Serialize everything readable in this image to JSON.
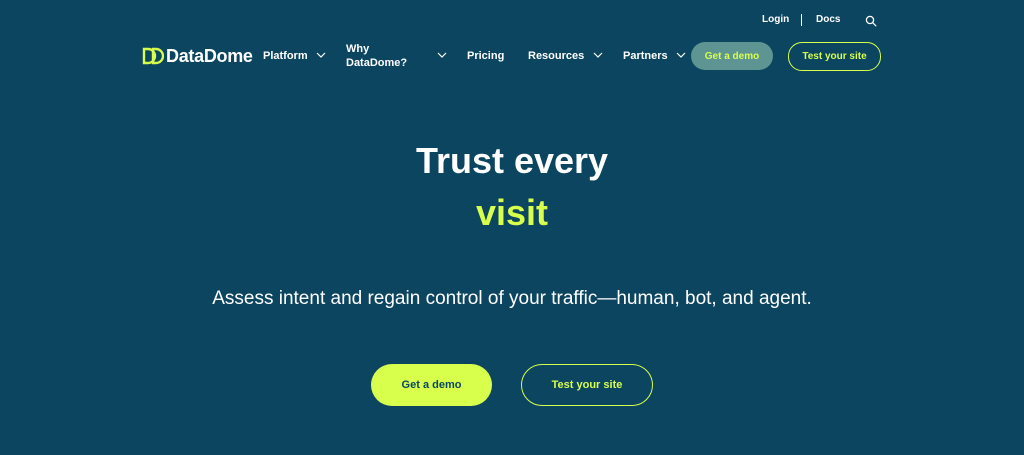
{
  "colors": {
    "background": "#0c4560",
    "accent": "#d7ff4c",
    "header_demo_bg": "#5e9592",
    "text": "#ffffff"
  },
  "topbar": {
    "login": "Login",
    "docs": "Docs",
    "search_icon": "search-icon"
  },
  "logo": {
    "text": "DataDome",
    "icon": "datadome-logo-mark"
  },
  "nav": {
    "platform": "Platform",
    "why_line1": "Why",
    "why_line2": "DataDome?",
    "pricing": "Pricing",
    "resources": "Resources",
    "partners": "Partners"
  },
  "header_buttons": {
    "demo": "Get a demo",
    "test": "Test your site"
  },
  "hero": {
    "title_line1": "Trust every",
    "title_line2": "visit",
    "subtitle": "Assess intent and regain control of your traffic—human, bot, and agent.",
    "cta_demo": "Get a demo",
    "cta_test": "Test your site"
  }
}
